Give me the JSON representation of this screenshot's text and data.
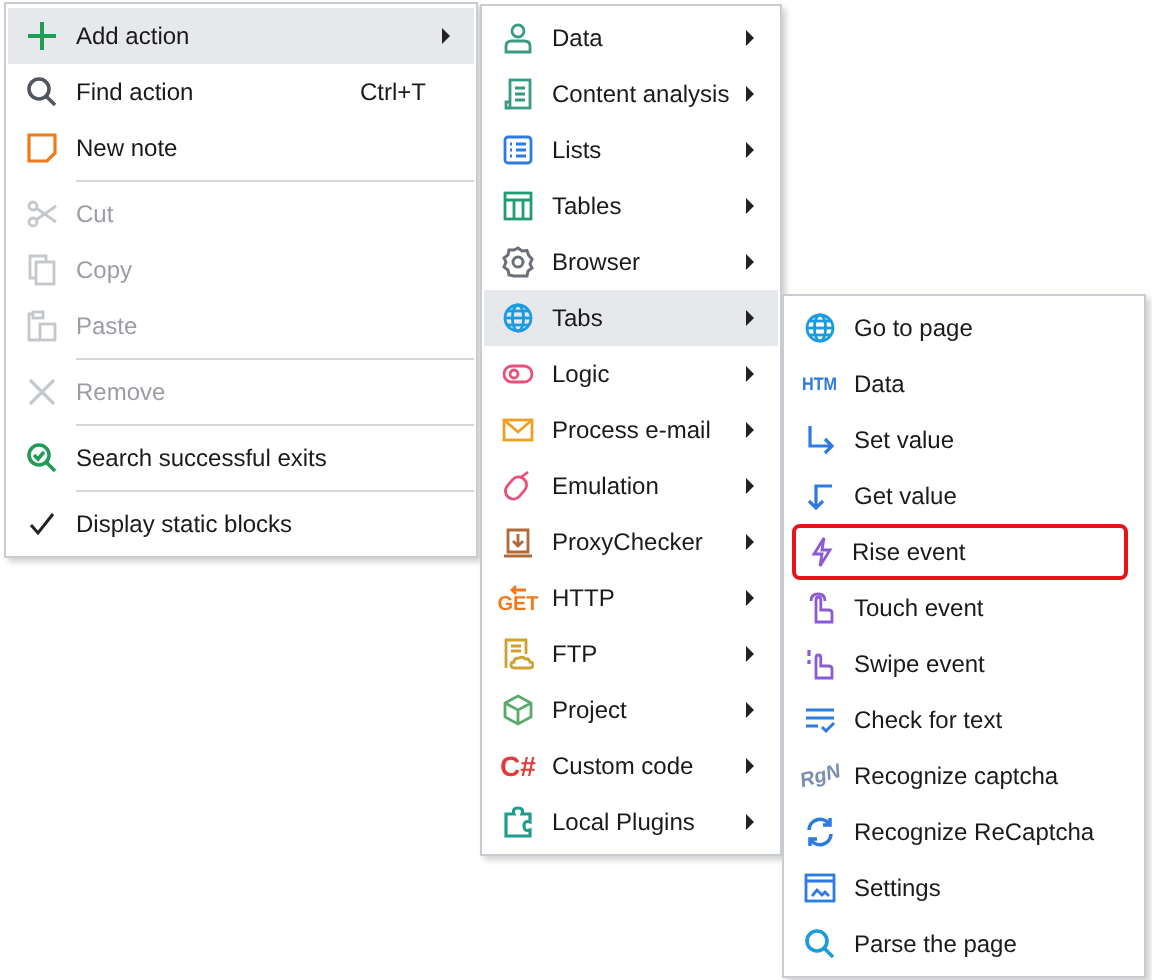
{
  "context_menu": {
    "items": [
      {
        "kind": "item",
        "label": "Add action",
        "selected": true,
        "disabled": false,
        "checked": false,
        "submenu": true
      },
      {
        "kind": "item",
        "label": "Find action",
        "shortcut": "Ctrl+T",
        "selected": false,
        "disabled": false,
        "checked": false,
        "submenu": false
      },
      {
        "kind": "item",
        "label": "New note",
        "selected": false,
        "disabled": false,
        "checked": false,
        "submenu": false
      },
      {
        "kind": "separator"
      },
      {
        "kind": "item",
        "label": "Cut",
        "selected": false,
        "disabled": true,
        "checked": false,
        "submenu": false
      },
      {
        "kind": "item",
        "label": "Copy",
        "selected": false,
        "disabled": true,
        "checked": false,
        "submenu": false
      },
      {
        "kind": "item",
        "label": "Paste",
        "selected": false,
        "disabled": true,
        "checked": false,
        "submenu": false
      },
      {
        "kind": "separator"
      },
      {
        "kind": "item",
        "label": "Remove",
        "selected": false,
        "disabled": true,
        "checked": false,
        "submenu": false
      },
      {
        "kind": "separator"
      },
      {
        "kind": "item",
        "label": "Search successful exits",
        "selected": false,
        "disabled": false,
        "checked": false,
        "submenu": false
      },
      {
        "kind": "separator"
      },
      {
        "kind": "item",
        "label": "Display static blocks",
        "selected": false,
        "disabled": false,
        "checked": true,
        "submenu": false
      }
    ]
  },
  "action_submenu": {
    "items": [
      {
        "label": "Data",
        "selected": false
      },
      {
        "label": "Content analysis",
        "selected": false
      },
      {
        "label": "Lists",
        "selected": false
      },
      {
        "label": "Tables",
        "selected": false
      },
      {
        "label": "Browser",
        "selected": false
      },
      {
        "label": "Tabs",
        "selected": true
      },
      {
        "label": "Logic",
        "selected": false
      },
      {
        "label": "Process e-mail",
        "selected": false
      },
      {
        "label": "Emulation",
        "selected": false
      },
      {
        "label": "ProxyChecker",
        "selected": false
      },
      {
        "label": "HTTP",
        "icon_text": "GET",
        "selected": false
      },
      {
        "label": "FTP",
        "selected": false
      },
      {
        "label": "Project",
        "selected": false
      },
      {
        "label": "Custom code",
        "icon_text": "C#",
        "selected": false
      },
      {
        "label": "Local Plugins",
        "selected": false
      }
    ]
  },
  "tabs_submenu": {
    "items": [
      {
        "label": "Go to page",
        "highlighted": false
      },
      {
        "label": "Data",
        "icon_text": "HTM",
        "highlighted": false
      },
      {
        "label": "Set value",
        "highlighted": false
      },
      {
        "label": "Get value",
        "highlighted": false
      },
      {
        "label": "Rise event",
        "highlighted": true
      },
      {
        "label": "Touch event",
        "highlighted": false
      },
      {
        "label": "Swipe event",
        "highlighted": false
      },
      {
        "label": "Check for text",
        "highlighted": false
      },
      {
        "label": "Recognize captcha",
        "icon_text": "RgN",
        "highlighted": false
      },
      {
        "label": "Recognize ReCaptcha",
        "highlighted": false
      },
      {
        "label": "Settings",
        "highlighted": false
      },
      {
        "label": "Parse the page",
        "highlighted": false
      }
    ]
  }
}
